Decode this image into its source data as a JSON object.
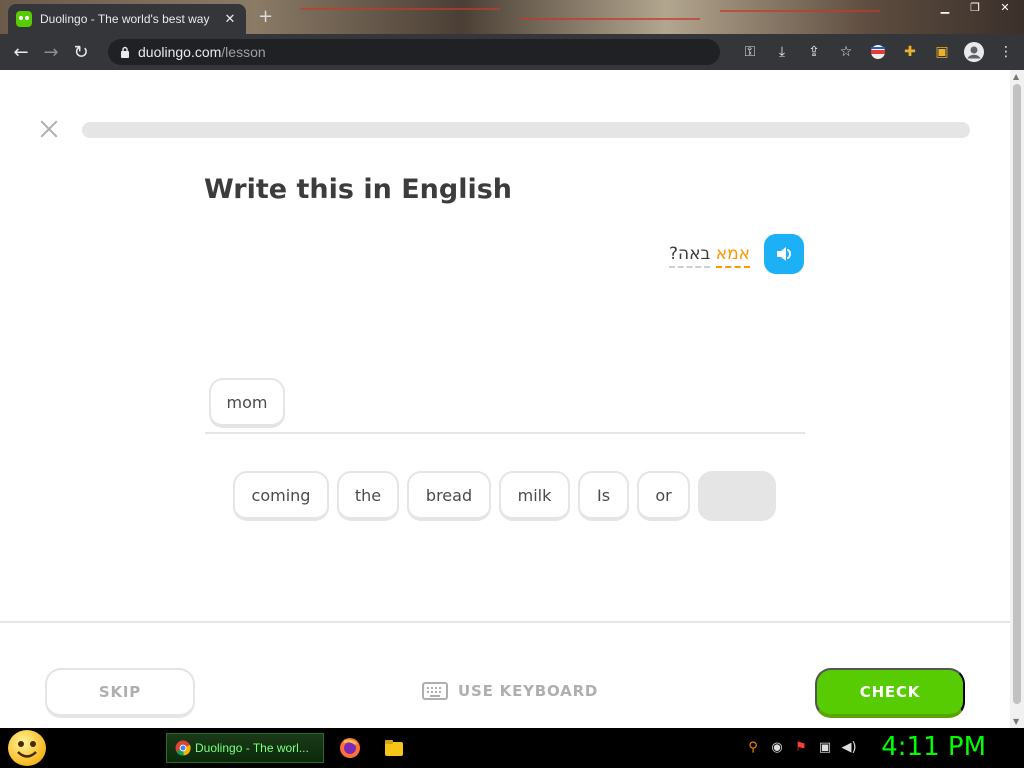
{
  "browser": {
    "tab_title": "Duolingo - The world's best way",
    "url_host": "duolingo.com",
    "url_path": "/lesson"
  },
  "lesson": {
    "progress": 0.0,
    "prompt_title": "Write this in English",
    "hebrew_words": [
      {
        "text": "אמא",
        "is_new": true
      },
      {
        "text": "באה?",
        "is_new": false
      }
    ],
    "answer_chips": [
      "mom"
    ],
    "word_bank": [
      {
        "text": "coming",
        "used": false
      },
      {
        "text": "the",
        "used": false
      },
      {
        "text": "bread",
        "used": false
      },
      {
        "text": "milk",
        "used": false
      },
      {
        "text": "Is",
        "used": false
      },
      {
        "text": "or",
        "used": false
      },
      {
        "text": "",
        "used": true
      }
    ],
    "skip_label": "SKIP",
    "keyboard_label": "USE KEYBOARD",
    "check_label": "CHECK"
  },
  "taskbar": {
    "active_task_label": "Duolingo - The worl...",
    "clock": "4:11 PM"
  },
  "colors": {
    "check_green": "#58cc02",
    "speaker_blue": "#1cb0f6",
    "new_word_orange": "#ff9600"
  }
}
